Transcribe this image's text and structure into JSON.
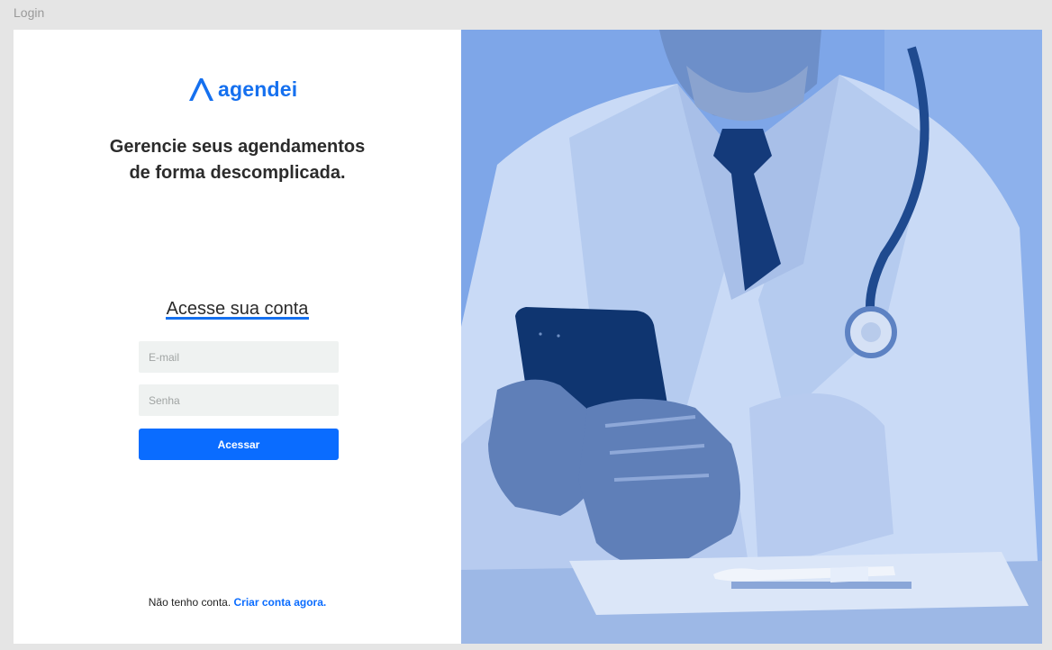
{
  "frame": {
    "label": "Login"
  },
  "brand": {
    "name": "agendei",
    "color": "#1570ef"
  },
  "headline": {
    "line1": "Gerencie seus agendamentos",
    "line2": "de forma descomplicada."
  },
  "login": {
    "title": "Acesse sua conta",
    "email_placeholder": "E-mail",
    "password_placeholder": "Senha",
    "submit_label": "Acessar"
  },
  "signup": {
    "prompt": "Não tenho conta.",
    "link_label": "Criar conta agora."
  },
  "hero": {
    "overlay_color": "#7ea6e8"
  }
}
